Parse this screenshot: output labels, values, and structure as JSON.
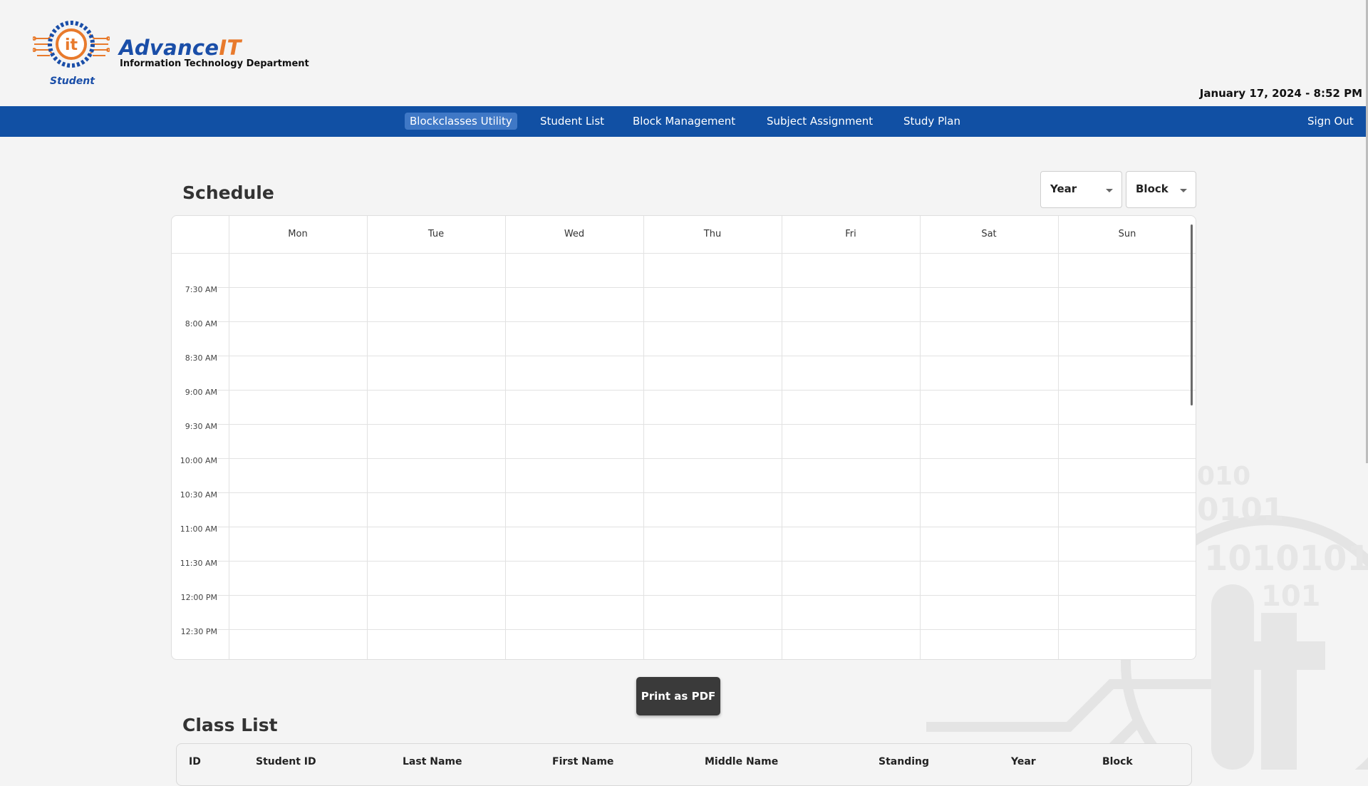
{
  "brand": {
    "name_main": "Advance",
    "name_accent": "IT",
    "subtitle": "Information Technology Department",
    "role": "Student"
  },
  "datetime": "January 17, 2024 - 8:52 PM",
  "nav": {
    "items": [
      {
        "label": "Blockclasses Utility",
        "active": true
      },
      {
        "label": "Student List"
      },
      {
        "label": "Block Management"
      },
      {
        "label": "Subject Assignment"
      },
      {
        "label": "Study Plan"
      }
    ],
    "signout": "Sign Out"
  },
  "schedule": {
    "title": "Schedule",
    "year_select": {
      "selected": "Year"
    },
    "block_select": {
      "selected": "Block"
    },
    "days": [
      "Mon",
      "Tue",
      "Wed",
      "Thu",
      "Fri",
      "Sat",
      "Sun"
    ],
    "times": [
      "7:30 AM",
      "8:00 AM",
      "8:30 AM",
      "9:00 AM",
      "9:30 AM",
      "10:00 AM",
      "10:30 AM",
      "11:00 AM",
      "11:30 AM",
      "12:00 PM",
      "12:30 PM"
    ]
  },
  "print_button": "Print as PDF",
  "class_list": {
    "title": "Class List",
    "columns": [
      "ID",
      "Student ID",
      "Last Name",
      "First Name",
      "Middle Name",
      "Standing",
      "Year",
      "Block"
    ]
  },
  "colors": {
    "nav_bg": "#1150a4",
    "brand_blue": "#1a4ea8",
    "brand_orange": "#e87a2c"
  }
}
